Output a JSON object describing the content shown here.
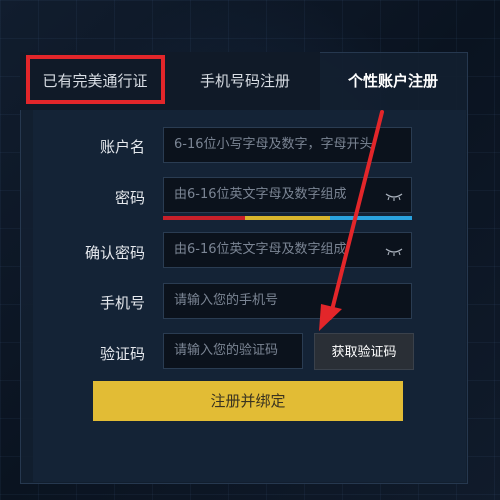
{
  "tabs": [
    {
      "label": "已有完美通行证"
    },
    {
      "label": "手机号码注册"
    },
    {
      "label": "个性账户注册"
    }
  ],
  "form": {
    "account": {
      "label": "账户名",
      "placeholder": "6-16位小写字母及数字，字母开头"
    },
    "password": {
      "label": "密码",
      "placeholder": "由6-16位英文字母及数字组成"
    },
    "confirm_password": {
      "label": "确认密码",
      "placeholder": "由6-16位英文字母及数字组成"
    },
    "phone": {
      "label": "手机号",
      "placeholder": "请输入您的手机号"
    },
    "code": {
      "label": "验证码",
      "placeholder": "请输入您的验证码"
    },
    "get_code_label": "获取验证码",
    "submit_label": "注册并绑定"
  },
  "colors": {
    "highlight": "#e3262a",
    "submit": "#e2bc35",
    "strength": [
      "#c8202a",
      "#d9b52d",
      "#2aa3e0"
    ],
    "arrow": "#e3262a"
  },
  "icons": {
    "password_toggle": "eye-closed-icon"
  }
}
